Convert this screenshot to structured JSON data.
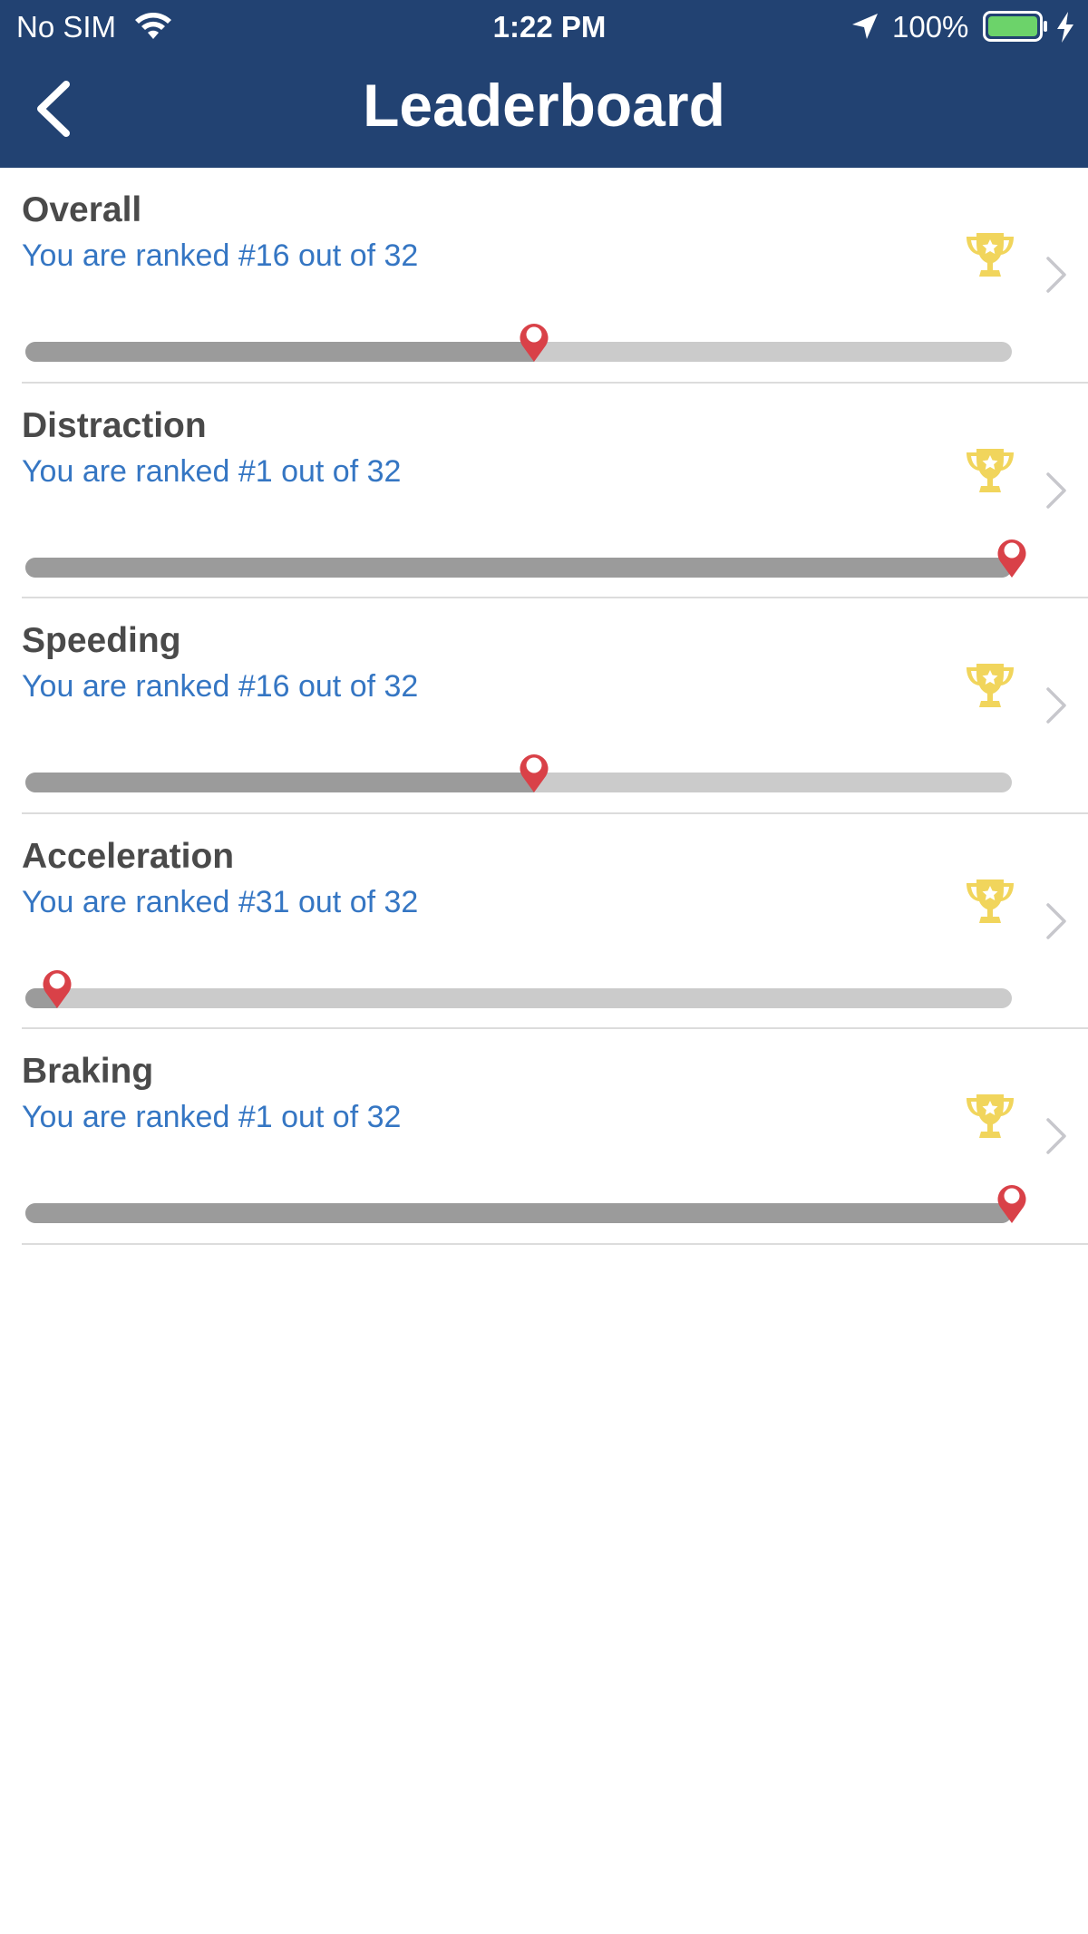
{
  "status_bar": {
    "carrier": "No SIM",
    "time": "1:22 PM",
    "battery_percent": "100%"
  },
  "nav": {
    "title": "Leaderboard",
    "back_icon": "chevron-left-icon"
  },
  "colors": {
    "header_bg": "#224272",
    "title_text": "#4a4a4a",
    "subtitle_text": "#3576c3",
    "track_bg": "#cbcbcb",
    "track_fill": "#9b9b9b",
    "pin": "#d94148",
    "trophy": "#f1d55c",
    "battery": "#6cd36a"
  },
  "leaderboard": {
    "items": [
      {
        "title": "Overall",
        "subtitle": "You are ranked #16 out of 32",
        "rank": 16,
        "total": 32,
        "progress": 0.516,
        "icon": "trophy-icon"
      },
      {
        "title": "Distraction",
        "subtitle": "You are ranked #1 out of 32",
        "rank": 1,
        "total": 32,
        "progress": 1.0,
        "icon": "trophy-icon"
      },
      {
        "title": "Speeding",
        "subtitle": "You are ranked #16 out of 32",
        "rank": 16,
        "total": 32,
        "progress": 0.516,
        "icon": "trophy-icon"
      },
      {
        "title": "Acceleration",
        "subtitle": "You are ranked #31 out of 32",
        "rank": 31,
        "total": 32,
        "progress": 0.032,
        "icon": "trophy-icon"
      },
      {
        "title": "Braking",
        "subtitle": "You are ranked #1 out of 32",
        "rank": 1,
        "total": 32,
        "progress": 1.0,
        "icon": "trophy-icon"
      }
    ]
  }
}
